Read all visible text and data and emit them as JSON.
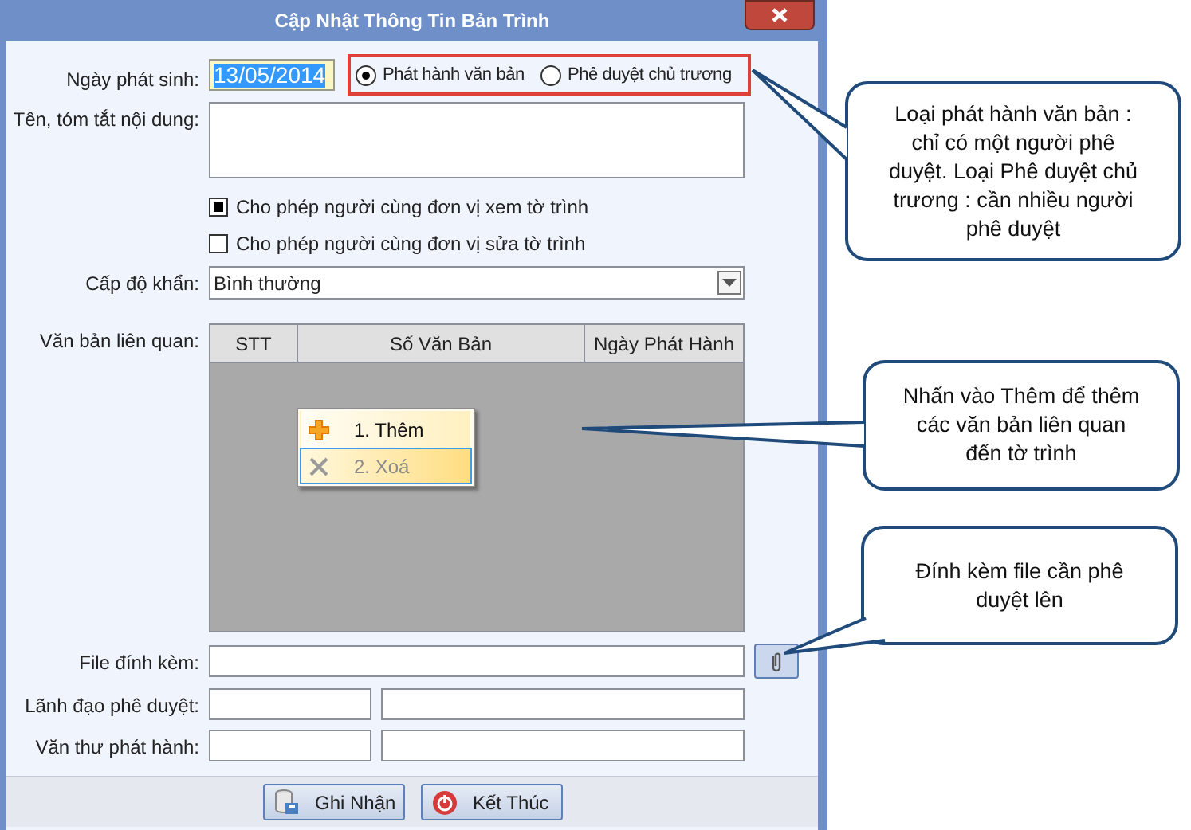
{
  "window": {
    "title": "Cập Nhật Thông Tin Bản Trình"
  },
  "form": {
    "date": {
      "label": "Ngày phát sinh:",
      "value": "13/05/2014"
    },
    "type_options": [
      {
        "label": "Phát hành văn bản",
        "selected": true
      },
      {
        "label": "Phê duyệt chủ trương",
        "selected": false
      }
    ],
    "content": {
      "label": "Tên, tóm tắt nội dung:"
    },
    "checkboxes": [
      {
        "label": "Cho phép người cùng đơn vị xem tờ trình",
        "checked": true
      },
      {
        "label": "Cho phép người cùng đơn vị sửa tờ trình",
        "checked": false
      }
    ],
    "urgency": {
      "label": "Cấp độ khẩn:",
      "value": "Bình thường"
    },
    "related": {
      "label": "Văn bản liên quan:",
      "columns": [
        "STT",
        "Số Văn Bản",
        "Ngày Phát Hành"
      ]
    },
    "context_menu": [
      {
        "label": "1. Thêm",
        "kind": "add",
        "disabled": false,
        "highlighted": false
      },
      {
        "label": "2. Xoá",
        "kind": "delete",
        "disabled": true,
        "highlighted": true
      }
    ],
    "attachment": {
      "label": "File đính kèm:"
    },
    "approver": {
      "label": "Lãnh đạo phê duyệt:"
    },
    "clerk": {
      "label": "Văn thư phát hành:"
    }
  },
  "buttons": [
    {
      "label": "Ghi Nhận",
      "kind": "save"
    },
    {
      "label": "Kết Thúc",
      "kind": "exit"
    }
  ],
  "callouts": [
    "Loại phát hành văn bản : chỉ có một người phê duyệt. Loại Phê duyệt chủ trương : cần nhiều người phê duyệt",
    "Nhấn vào Thêm để thêm các văn bản liên quan đến tờ trình",
    "Đính kèm file cần phê duyệt lên"
  ]
}
